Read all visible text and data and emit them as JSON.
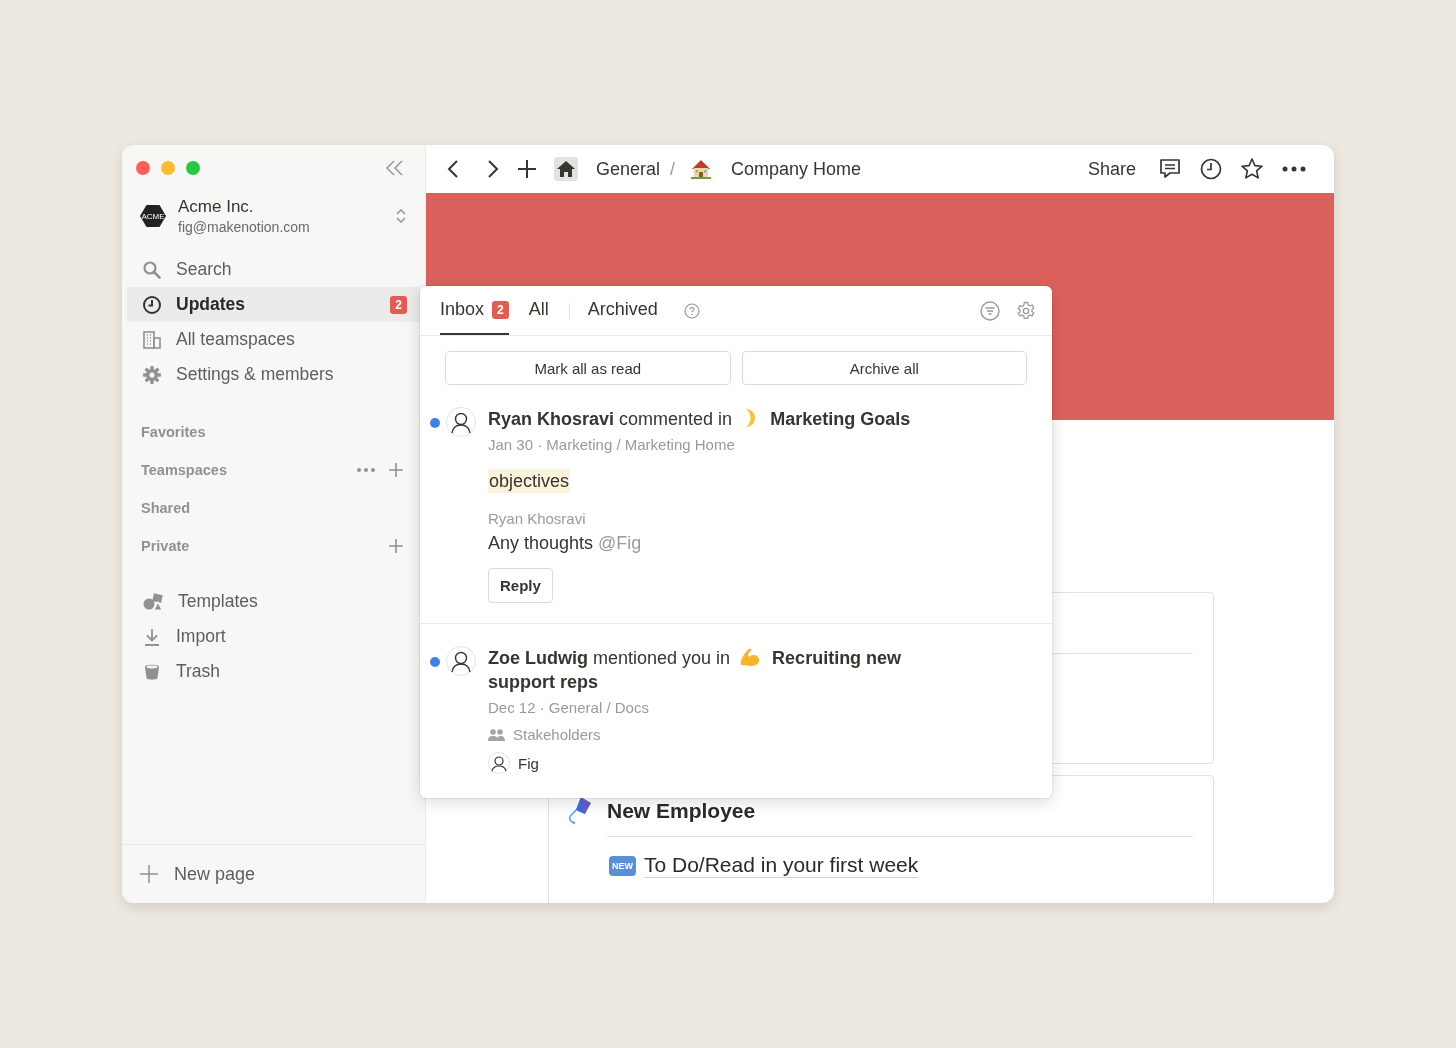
{
  "sidebar": {
    "workspace": {
      "name": "Acme Inc.",
      "email": "fig@makenotion.com",
      "logo": "ACME"
    },
    "nav": [
      {
        "label": "Search",
        "selected": false
      },
      {
        "label": "Updates",
        "selected": true,
        "badge": "2"
      },
      {
        "label": "All teamspaces",
        "selected": false
      },
      {
        "label": "Settings & members",
        "selected": false
      }
    ],
    "sections": [
      {
        "label": "Favorites",
        "more": false,
        "add": false
      },
      {
        "label": "Teamspaces",
        "more": true,
        "add": true
      },
      {
        "label": "Shared",
        "more": false,
        "add": false
      },
      {
        "label": "Private",
        "more": false,
        "add": true
      }
    ],
    "tools": [
      {
        "label": "Templates"
      },
      {
        "label": "Import"
      },
      {
        "label": "Trash"
      }
    ],
    "new_page": "New page"
  },
  "topbar": {
    "breadcrumb": [
      {
        "label": "General"
      },
      {
        "label": "Company Home"
      }
    ],
    "separator": "/",
    "share": "Share"
  },
  "page": {
    "cards": [
      {
        "title": "New Employee",
        "items": [
          {
            "badge": "NEW",
            "label": "To Do/Read in your first week"
          }
        ]
      }
    ]
  },
  "inbox": {
    "tabs": [
      {
        "label": "Inbox",
        "badge": "2",
        "selected": true
      },
      {
        "label": "All",
        "selected": false
      },
      {
        "label": "Archived",
        "selected": false
      }
    ],
    "buttons": [
      "Mark all as read",
      "Archive all"
    ],
    "notifications": [
      {
        "kind": "comment",
        "unread": true,
        "headline": "**Ryan Khosravi** commented in",
        "page": "Marketing Goals",
        "meta": "Jan 30 · Marketing / Marketing Home",
        "highlight": "objectives",
        "comment_author": "Ryan Khosravi",
        "comment_text": "Any thoughts",
        "mention": "@Fig",
        "reply": "Reply"
      },
      {
        "kind": "mention",
        "unread": true,
        "headline": "**Zoe Ludwig** mentioned you in",
        "page": "Recruiting new support reps",
        "meta": "Dec 12 · General / Docs",
        "property": "Stakeholders",
        "person": "Fig"
      }
    ]
  }
}
